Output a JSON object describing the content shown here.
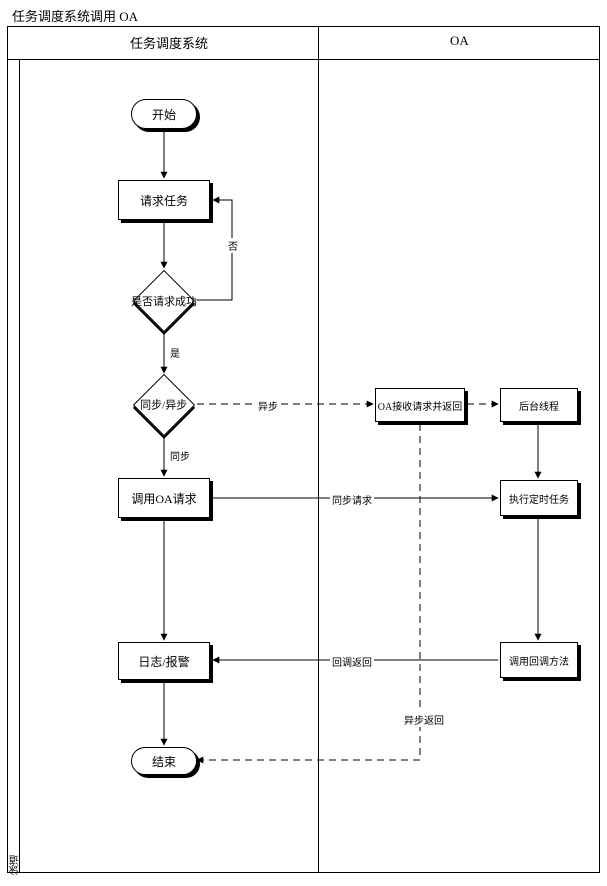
{
  "title": "任务调度系统调用 OA",
  "side_label": "泳道",
  "lanes": {
    "lane1": "任务调度系统",
    "lane2": "OA"
  },
  "nodes": {
    "start": "开始",
    "req_task": "请求任务",
    "dec_success": "是否请求成功",
    "dec_mode": "同步/异步",
    "call_oa": "调用OA请求",
    "log_alarm": "日志/报警",
    "end": "结束",
    "oa_recv": "OA接收请求并返回",
    "bg_thread": "后台线程",
    "exec_timer": "执行定时任务",
    "call_cb": "调用回调方法"
  },
  "edge_labels": {
    "no": "否",
    "yes": "是",
    "async": "异步",
    "sync": "同步",
    "sync_req": "同步请求",
    "cb_return": "回调返回",
    "async_return": "异步返回"
  },
  "chart_data": {
    "type": "flowchart-swimlane",
    "title": "任务调度系统调用 OA",
    "lanes": [
      "任务调度系统",
      "OA"
    ],
    "nodes": [
      {
        "id": "start",
        "lane": "任务调度系统",
        "shape": "terminator",
        "label": "开始"
      },
      {
        "id": "req_task",
        "lane": "任务调度系统",
        "shape": "process",
        "label": "请求任务"
      },
      {
        "id": "dec_success",
        "lane": "任务调度系统",
        "shape": "decision",
        "label": "是否请求成功"
      },
      {
        "id": "dec_mode",
        "lane": "任务调度系统",
        "shape": "decision",
        "label": "同步/异步"
      },
      {
        "id": "call_oa",
        "lane": "任务调度系统",
        "shape": "process",
        "label": "调用OA请求"
      },
      {
        "id": "log_alarm",
        "lane": "任务调度系统",
        "shape": "process",
        "label": "日志/报警"
      },
      {
        "id": "end",
        "lane": "任务调度系统",
        "shape": "terminator",
        "label": "结束"
      },
      {
        "id": "oa_recv",
        "lane": "OA",
        "shape": "process",
        "label": "OA接收请求并返回"
      },
      {
        "id": "bg_thread",
        "lane": "OA",
        "shape": "process",
        "label": "后台线程"
      },
      {
        "id": "exec_timer",
        "lane": "OA",
        "shape": "process",
        "label": "执行定时任务"
      },
      {
        "id": "call_cb",
        "lane": "OA",
        "shape": "process",
        "label": "调用回调方法"
      }
    ],
    "edges": [
      {
        "from": "start",
        "to": "req_task",
        "style": "solid"
      },
      {
        "from": "req_task",
        "to": "dec_success",
        "style": "solid"
      },
      {
        "from": "dec_success",
        "to": "req_task",
        "label": "否",
        "style": "solid"
      },
      {
        "from": "dec_success",
        "to": "dec_mode",
        "label": "是",
        "style": "solid"
      },
      {
        "from": "dec_mode",
        "to": "call_oa",
        "label": "同步",
        "style": "solid"
      },
      {
        "from": "dec_mode",
        "to": "oa_recv",
        "label": "异步",
        "style": "dashed"
      },
      {
        "from": "oa_recv",
        "to": "bg_thread",
        "style": "dashed"
      },
      {
        "from": "bg_thread",
        "to": "exec_timer",
        "style": "solid"
      },
      {
        "from": "call_oa",
        "to": "exec_timer",
        "label": "同步请求",
        "style": "solid"
      },
      {
        "from": "call_oa",
        "to": "log_alarm",
        "style": "solid"
      },
      {
        "from": "exec_timer",
        "to": "call_cb",
        "style": "solid"
      },
      {
        "from": "call_cb",
        "to": "log_alarm",
        "label": "回调返回",
        "style": "solid"
      },
      {
        "from": "oa_recv",
        "to": "end",
        "label": "异步返回",
        "style": "dashed"
      },
      {
        "from": "log_alarm",
        "to": "end",
        "style": "solid"
      }
    ]
  }
}
